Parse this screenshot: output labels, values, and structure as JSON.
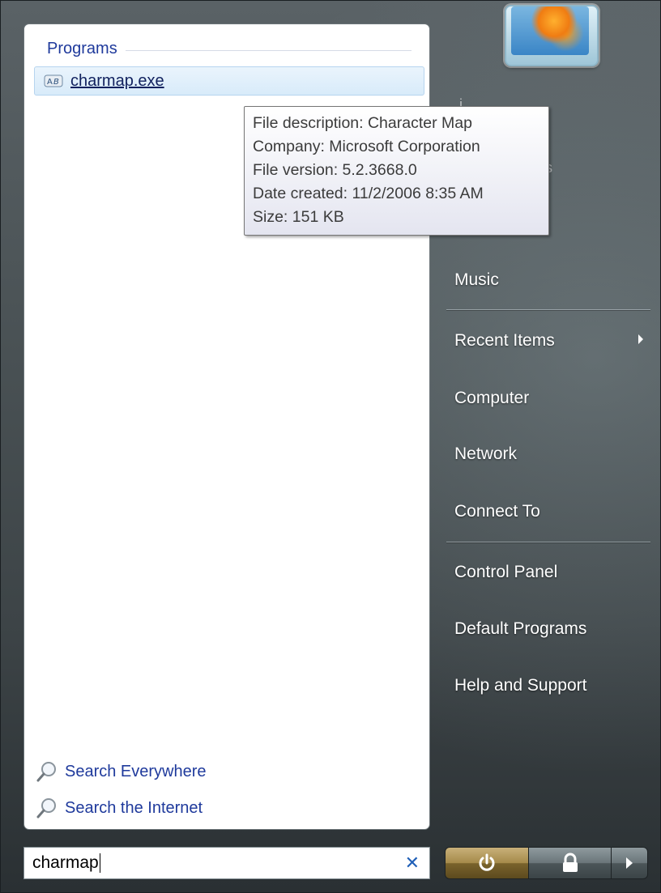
{
  "programs": {
    "header": "Programs",
    "result": {
      "label": "charmap.exe",
      "icon": "character-map-icon"
    }
  },
  "tooltip": {
    "lines": [
      "File description: Character Map",
      "Company: Microsoft Corporation",
      "File version: 5.2.3668.0",
      "Date created: 11/2/2006 8:35 AM",
      "Size: 151 KB"
    ]
  },
  "search_links": {
    "everywhere": {
      "label": "Search Everywhere",
      "icon": "magnifier-icon"
    },
    "internet": {
      "label": "Search the Internet",
      "icon": "magnifier-icon"
    }
  },
  "right_menu": {
    "music": "Music",
    "recent_items": "Recent Items",
    "computer": "Computer",
    "network": "Network",
    "connect_to": "Connect To",
    "control_panel": "Control Panel",
    "default_programs": "Default Programs",
    "help_support": "Help and Support"
  },
  "search_box": {
    "value": "charmap",
    "clear_icon": "close-icon"
  },
  "power": {
    "power_icon": "power-icon",
    "lock_icon": "lock-icon",
    "more_icon": "arrow-right-icon"
  }
}
